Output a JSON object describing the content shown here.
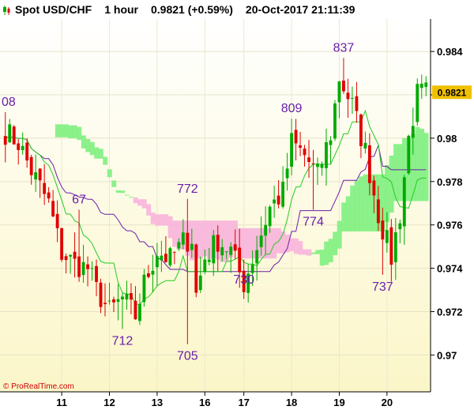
{
  "header": {
    "symbol": "Spot USD/CHF",
    "timeframe": "1 hour",
    "price": "0.9821 (+0.59%)",
    "datetime": "20-Oct-2017 21:11:39"
  },
  "copyright": "© ProRealTime.com",
  "colors": {
    "candle_up": "#00aa00",
    "candle_down": "#e00000",
    "kijun": "#6a1fa8",
    "tenkan": "#22cc22",
    "cloud_bull": "#80f080",
    "cloud_bear": "#f8b4dc",
    "background_top": "#ffffff",
    "background_bottom": "#fbf6c8",
    "price_label": "#f0c000",
    "annotation": "#6a1fa8"
  },
  "chart_data": {
    "type": "candlestick",
    "title": "Spot USD/CHF 1 hour",
    "ylim": [
      0.9683,
      0.9855
    ],
    "y_ticks": [
      "0.984",
      "0.982",
      "0.98",
      "0.978",
      "0.976",
      "0.974",
      "0.972",
      "0.97"
    ],
    "y_tick_values": [
      0.984,
      0.982,
      0.98,
      0.978,
      0.976,
      0.974,
      0.972,
      0.97
    ],
    "x_ticks": [
      "11",
      "12",
      "13",
      "16",
      "17",
      "18",
      "19",
      "20"
    ],
    "x_tick_index": [
      13,
      24,
      35,
      46,
      55,
      66,
      77,
      88
    ],
    "last_price": "0.9821",
    "last_price_value": 0.9821,
    "bar_count": 98,
    "close_path": [
      [
        0,
        0.9803
      ],
      [
        3,
        0.9798
      ],
      [
        6,
        0.9785
      ],
      [
        10,
        0.977
      ],
      [
        13,
        0.9747
      ],
      [
        16,
        0.9742
      ],
      [
        19,
        0.974
      ],
      [
        21,
        0.973
      ],
      [
        24,
        0.972
      ],
      [
        27,
        0.9726
      ],
      [
        30,
        0.9718
      ],
      [
        32,
        0.9733
      ],
      [
        35,
        0.9748
      ],
      [
        38,
        0.9744
      ],
      [
        41,
        0.9752
      ],
      [
        43,
        0.9754
      ],
      [
        44,
        0.9728
      ],
      [
        46,
        0.9745
      ],
      [
        49,
        0.9753
      ],
      [
        52,
        0.9748
      ],
      [
        55,
        0.9733
      ],
      [
        58,
        0.975
      ],
      [
        61,
        0.9768
      ],
      [
        64,
        0.9775
      ],
      [
        66,
        0.9798
      ],
      [
        69,
        0.9792
      ],
      [
        72,
        0.9783
      ],
      [
        75,
        0.9802
      ],
      [
        77,
        0.9828
      ],
      [
        80,
        0.9815
      ],
      [
        83,
        0.9794
      ],
      [
        86,
        0.9765
      ],
      [
        89,
        0.9745
      ],
      [
        91,
        0.9765
      ],
      [
        93,
        0.98
      ],
      [
        95,
        0.982
      ],
      [
        97,
        0.9821
      ]
    ],
    "annotations": [
      {
        "label": "08",
        "index": 0,
        "value": 0.9812
      },
      {
        "label": "67",
        "index": 17,
        "value": 0.9767
      },
      {
        "label": "712",
        "index": 27,
        "value": 0.9712
      },
      {
        "label": "772",
        "index": 42,
        "value": 0.9772
      },
      {
        "label": "705",
        "index": 42,
        "value": 0.9705
      },
      {
        "label": "730",
        "index": 55,
        "value": 0.973
      },
      {
        "label": "809",
        "index": 66,
        "value": 0.9809
      },
      {
        "label": "774",
        "index": 71,
        "value": 0.9767
      },
      {
        "label": "837",
        "index": 78,
        "value": 0.9837
      },
      {
        "label": "737",
        "index": 87,
        "value": 0.9737
      }
    ]
  }
}
